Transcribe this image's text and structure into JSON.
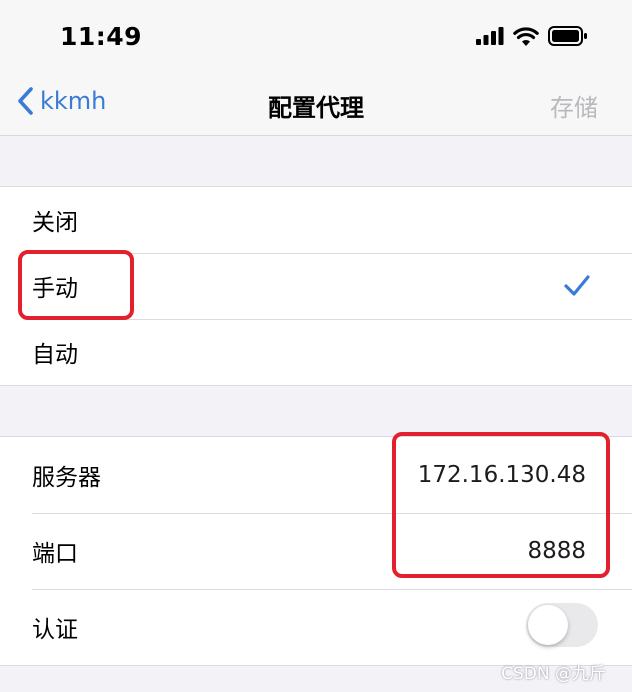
{
  "status_bar": {
    "time": "11:49"
  },
  "nav": {
    "back_label": "kkmh",
    "title": "配置代理",
    "save_label": "存储"
  },
  "proxy_mode": {
    "options": [
      {
        "label": "关闭"
      },
      {
        "label": "手动"
      },
      {
        "label": "自动"
      }
    ],
    "selected": "手动"
  },
  "settings": {
    "server_label": "服务器",
    "server_value": "172.16.130.48",
    "port_label": "端口",
    "port_value": "8888",
    "auth_label": "认证",
    "auth_enabled": false
  },
  "annotation_color": "#e3202e",
  "accent_color": "#3a7bd5",
  "watermark": "CSDN @九斤"
}
